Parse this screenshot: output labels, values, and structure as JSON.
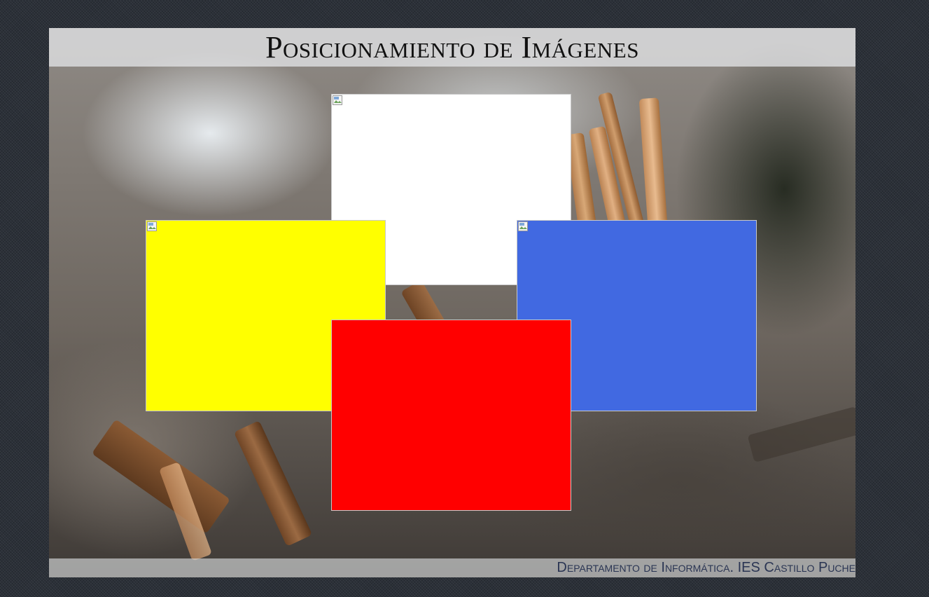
{
  "header": {
    "title": "Posicionamiento de Imágenes"
  },
  "footer": {
    "text": "Departamento de Informática. IES Castillo Puche"
  },
  "images": [
    {
      "id": "top",
      "color": "#ffffff",
      "icon": "broken-image-icon"
    },
    {
      "id": "left",
      "color": "#ffff00",
      "icon": "broken-image-icon"
    },
    {
      "id": "right",
      "color": "#4169e1",
      "icon": "broken-image-icon"
    },
    {
      "id": "bottom",
      "color": "#ff0000",
      "icon": "broken-image-icon"
    }
  ]
}
